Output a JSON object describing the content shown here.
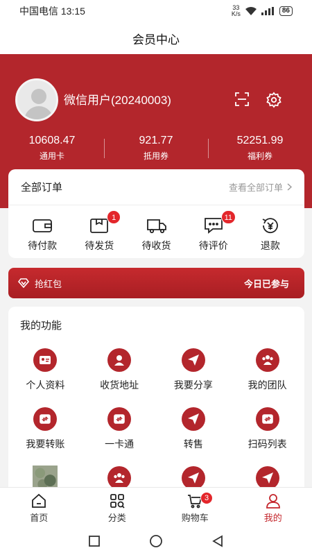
{
  "status_bar": {
    "carrier": "中国电信",
    "time": "13:15",
    "net_speed_value": "33",
    "net_speed_unit": "K/s",
    "battery": "86"
  },
  "header": {
    "title": "会员中心"
  },
  "profile": {
    "username": "微信用户(20240003)",
    "balances": [
      {
        "value": "10608.47",
        "label": "通用卡"
      },
      {
        "value": "921.77",
        "label": "抵用券"
      },
      {
        "value": "52251.99",
        "label": "福利券"
      }
    ]
  },
  "orders": {
    "title": "全部订单",
    "view_all": "查看全部订单",
    "items": [
      {
        "label": "待付款",
        "icon": "wallet-icon",
        "badge": ""
      },
      {
        "label": "待发货",
        "icon": "package-icon",
        "badge": "1"
      },
      {
        "label": "待收货",
        "icon": "truck-icon",
        "badge": ""
      },
      {
        "label": "待评价",
        "icon": "comment-icon",
        "badge": "11"
      },
      {
        "label": "退款",
        "icon": "refund-icon",
        "badge": ""
      }
    ]
  },
  "red_packet": {
    "label": "抢红包",
    "status": "今日已参与"
  },
  "functions": {
    "title": "我的功能",
    "items": [
      {
        "label": "个人资料",
        "icon": "profile-card-icon"
      },
      {
        "label": "收货地址",
        "icon": "address-icon"
      },
      {
        "label": "我要分享",
        "icon": "share-icon"
      },
      {
        "label": "我的团队",
        "icon": "team-icon"
      },
      {
        "label": "我要转账",
        "icon": "transfer-icon"
      },
      {
        "label": "一卡通",
        "icon": "card-icon"
      },
      {
        "label": "转售",
        "icon": "resell-icon"
      },
      {
        "label": "扫码列表",
        "icon": "scan-list-icon"
      },
      {
        "label": "",
        "icon": "tea-thumbnail"
      },
      {
        "label": "",
        "icon": "team-icon"
      },
      {
        "label": "",
        "icon": "share-icon"
      },
      {
        "label": "",
        "icon": "share-icon"
      }
    ]
  },
  "tabbar": {
    "items": [
      {
        "label": "首页",
        "icon": "home-icon"
      },
      {
        "label": "分类",
        "icon": "category-icon"
      },
      {
        "label": "购物车",
        "icon": "cart-icon",
        "badge": "3"
      },
      {
        "label": "我的",
        "icon": "user-icon",
        "active": true
      }
    ]
  },
  "colors": {
    "brand_red": "#b3262c",
    "badge_red": "#e3262b",
    "active_tab": "#c4262c"
  }
}
